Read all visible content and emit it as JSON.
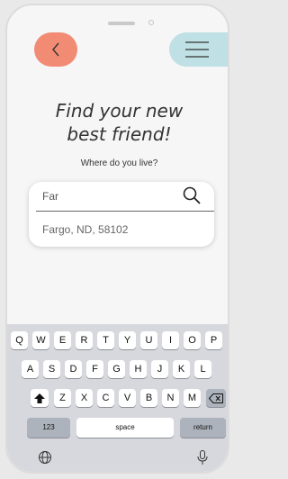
{
  "nav": {
    "back_icon": "chevron-left-icon",
    "menu_icon": "hamburger-icon",
    "back_color": "#f28b74",
    "menu_color": "#bfe0e4"
  },
  "hero": {
    "line1": "Find your new",
    "line2": "best friend!",
    "subtitle": "Where do you live?"
  },
  "search": {
    "value": "Far",
    "suggestion": "Fargo, ND, 58102",
    "icon": "search-icon"
  },
  "keyboard": {
    "row1": [
      "Q",
      "W",
      "E",
      "R",
      "T",
      "Y",
      "U",
      "I",
      "O",
      "P"
    ],
    "row2": [
      "A",
      "S",
      "D",
      "F",
      "G",
      "H",
      "J",
      "K",
      "L"
    ],
    "row3": [
      "Z",
      "X",
      "C",
      "V",
      "B",
      "N",
      "M"
    ],
    "numbers": "123",
    "space": "space",
    "return": "return",
    "shift_icon": "shift-icon",
    "delete_icon": "backspace-icon",
    "globe_icon": "globe-icon",
    "mic_icon": "microphone-icon"
  }
}
